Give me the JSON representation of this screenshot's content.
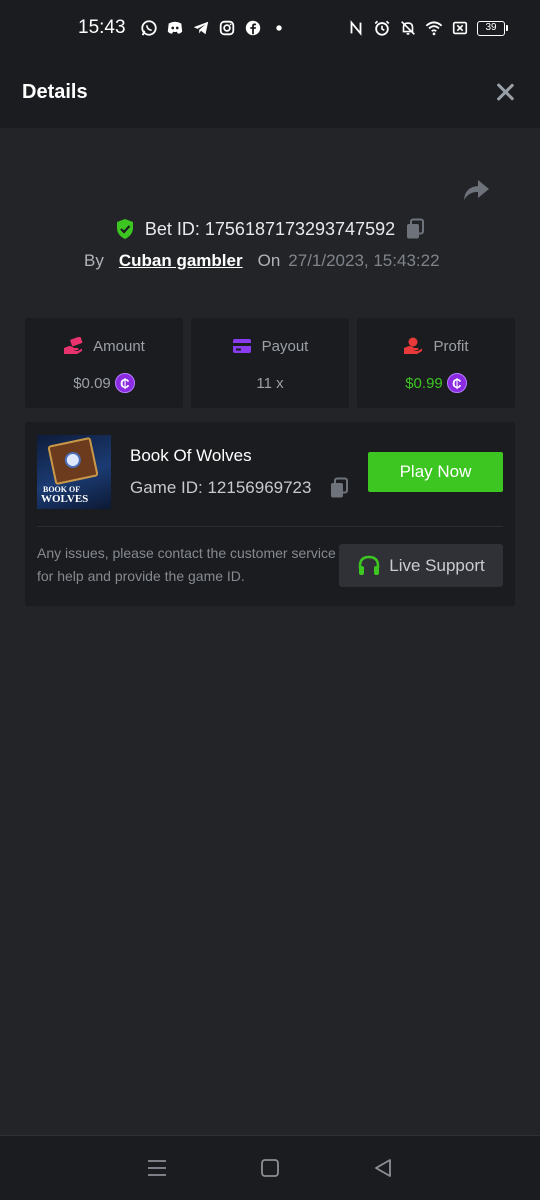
{
  "status_bar": {
    "time": "15:43",
    "battery": "39",
    "left_icons": [
      "whatsapp-icon",
      "discord-icon",
      "telegram-icon",
      "instagram-icon",
      "facebook-icon",
      "dot-icon"
    ],
    "right_icons": [
      "nfc-icon",
      "alarm-icon",
      "bell-off-icon",
      "wifi-icon",
      "sim-off-icon",
      "battery-icon"
    ]
  },
  "header": {
    "title": "Details",
    "close_icon": "close-icon"
  },
  "bet": {
    "bet_id": "Bet ID: 1756187173293747592",
    "by_label": "By",
    "user": "Cuban gambler",
    "on_label": "On",
    "datetime": "27/1/2023, 15:43:22"
  },
  "stats": {
    "amount": {
      "label": "Amount",
      "value": "$0.09",
      "icon": "hand-money-icon",
      "color": "#e8336e"
    },
    "payout": {
      "label": "Payout",
      "value": "11 x",
      "icon": "card-icon",
      "color": "#8a3cf0"
    },
    "profit": {
      "label": "Profit",
      "value": "$0.99",
      "icon": "profit-hand-icon",
      "color": "#e83a3a",
      "value_color": "#3dc521"
    },
    "coin_symbol": "₵"
  },
  "game": {
    "name": "Book Of Wolves",
    "game_id": "Game ID: 12156969723",
    "play_label": "Play Now",
    "thumb_text_1": "BOOK OF",
    "thumb_text_2": "WOLVES",
    "help_text": "Any issues, please contact the customer service for help and provide the game ID.",
    "support_label": "Live Support"
  },
  "colors": {
    "background": "#232428",
    "panel": "#1b1c1f",
    "accent_green": "#3dc521",
    "coin_purple": "#8a2be2"
  },
  "nav": [
    "menu-icon",
    "home-icon",
    "back-icon"
  ]
}
